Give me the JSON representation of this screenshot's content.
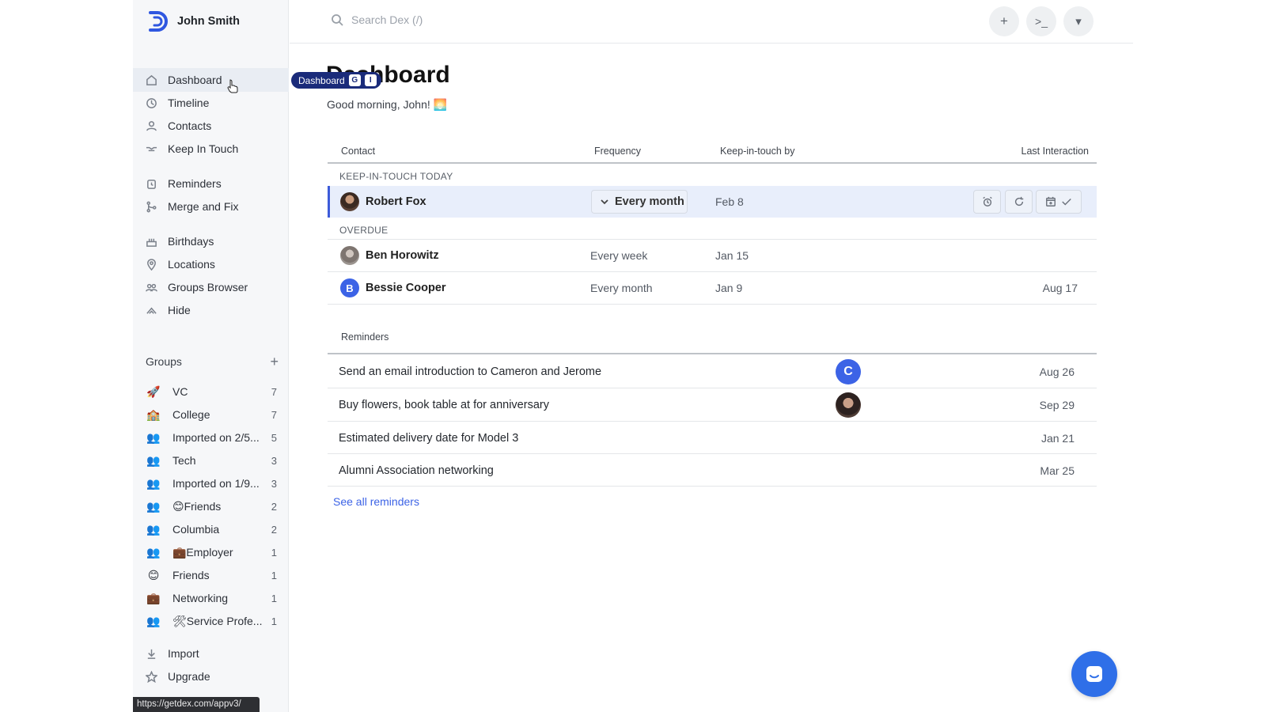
{
  "profile": {
    "name": "John Smith"
  },
  "nav": [
    {
      "label": "Dashboard",
      "icon": "home-icon"
    },
    {
      "label": "Timeline",
      "icon": "clock-icon"
    },
    {
      "label": "Contacts",
      "icon": "person-icon"
    },
    {
      "label": "Keep In Touch",
      "icon": "handshake-icon"
    },
    {
      "label": "Reminders",
      "icon": "alarm-icon"
    },
    {
      "label": "Merge and Fix",
      "icon": "merge-icon"
    },
    {
      "label": "Birthdays",
      "icon": "cake-icon"
    },
    {
      "label": "Locations",
      "icon": "pin-icon"
    },
    {
      "label": "Groups Browser",
      "icon": "people-icon"
    },
    {
      "label": "Hide",
      "icon": "hide-icon"
    },
    {
      "label": "Import",
      "icon": "download-icon"
    },
    {
      "label": "Upgrade",
      "icon": "star-icon"
    }
  ],
  "groups": {
    "header": "Groups",
    "add": "+",
    "items": [
      {
        "icon": "🚀",
        "label": "VC",
        "count": "7"
      },
      {
        "icon": "🏫",
        "label": "College",
        "count": "7"
      },
      {
        "icon": "👥",
        "label": "Imported on 2/5...",
        "count": "5"
      },
      {
        "icon": "👥",
        "label": "Tech",
        "count": "3"
      },
      {
        "icon": "👥",
        "label": "Imported on 1/9...",
        "count": "3"
      },
      {
        "icon": "👥",
        "label": "😊Friends",
        "count": "2"
      },
      {
        "icon": "👥",
        "label": "Columbia",
        "count": "2"
      },
      {
        "icon": "👥",
        "label": "💼Employer",
        "count": "1"
      },
      {
        "icon": "😊",
        "label": "Friends",
        "count": "1"
      },
      {
        "icon": "💼",
        "label": "Networking",
        "count": "1"
      },
      {
        "icon": "👥",
        "label": "🛠Service Profe...",
        "count": "1"
      }
    ]
  },
  "status_url": "https://getdex.com/appv3/",
  "search": {
    "placeholder": "Search Dex (/)"
  },
  "topbar": {
    "add": "+",
    "terminal": ">_",
    "menu": "▾"
  },
  "tooltip": {
    "label": "Dashboard",
    "key1": "G",
    "key2": "I"
  },
  "page": {
    "title": "Dashboard",
    "greeting": "Good morning, John! 🌅"
  },
  "table": {
    "headers": {
      "contact": "Contact",
      "frequency": "Frequency",
      "keep_by": "Keep-in-touch by",
      "last": "Last Interaction"
    },
    "sections": {
      "today": "KEEP-IN-TOUCH TODAY",
      "overdue": "OVERDUE"
    },
    "today": {
      "name": "Robert Fox",
      "frequency": "Every month",
      "date": "Feb 8"
    },
    "overdue": [
      {
        "name": "Ben Horowitz",
        "frequency": "Every week",
        "date": "Jan 15",
        "last": ""
      },
      {
        "name": "Bessie Cooper",
        "initial": "B",
        "frequency": "Every month",
        "date": "Jan 9",
        "last": "Aug 17"
      }
    ]
  },
  "reminders": {
    "header": "Reminders",
    "items": [
      {
        "title": "Send an email introduction to Cameron and Jerome",
        "avatar": "C",
        "date": "Aug 26"
      },
      {
        "title": "Buy flowers, book table at for anniversary",
        "date": "Sep 29"
      },
      {
        "title": "Estimated delivery date for Model 3",
        "date": "Jan 21"
      },
      {
        "title": "Alumni Association networking",
        "date": "Mar 25"
      }
    ],
    "see_all": "See all reminders"
  }
}
